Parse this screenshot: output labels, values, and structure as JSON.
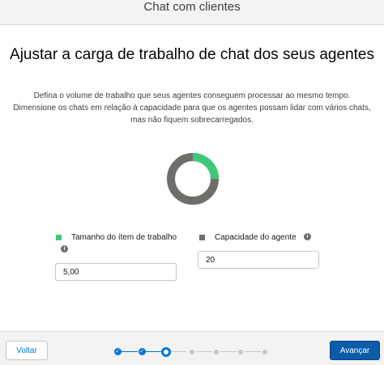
{
  "header": {
    "title": "Chat com clientes"
  },
  "main": {
    "title": "Ajustar a carga de trabalho de chat dos seus agentes",
    "description": "Defina o volume de trabalho que seus agentes conseguem processar ao mesmo tempo. Dimensione os chats em relação à capacidade para que os agentes possam lidar com vários chats, mas não fiquem sobrecarregados."
  },
  "donut": {
    "work_item_fraction": 0.25,
    "colors": {
      "work_item": "#3ec97a",
      "capacity": "#706e6b"
    }
  },
  "fields": {
    "work_item_size": {
      "label": "Tamanho do ítem de trabalho",
      "value": "5,00"
    },
    "agent_capacity": {
      "label": "Capacidade do agente",
      "value": "20"
    }
  },
  "footer": {
    "back_label": "Voltar",
    "next_label": "Avançar",
    "progress": {
      "total_steps": 7,
      "completed_steps": 2,
      "current_step": 3
    }
  },
  "icons": {
    "info": "info-icon",
    "step_complete": "check-icon"
  }
}
